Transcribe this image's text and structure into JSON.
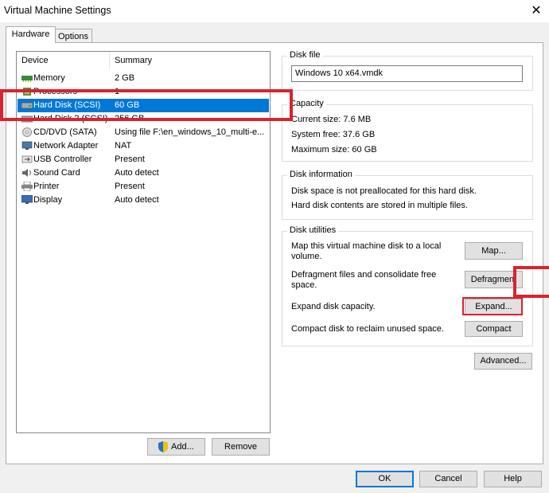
{
  "window": {
    "title": "Virtual Machine Settings",
    "close_glyph": "✕"
  },
  "tabs": [
    {
      "label": "Hardware"
    },
    {
      "label": "Options"
    }
  ],
  "device_list": {
    "headers": {
      "device": "Device",
      "summary": "Summary"
    },
    "rows": [
      {
        "device": "Memory",
        "summary": "2 GB",
        "icon": "memory-icon"
      },
      {
        "device": "Processors",
        "summary": "1",
        "icon": "processor-icon"
      },
      {
        "device": "Hard Disk (SCSI)",
        "summary": "60 GB",
        "icon": "hard-disk-icon",
        "selected": true
      },
      {
        "device": "Hard Disk 2 (SCSI)",
        "summary": "256 GB",
        "icon": "hard-disk-icon"
      },
      {
        "device": "CD/DVD (SATA)",
        "summary": "Using file F:\\en_windows_10_multi-e...",
        "icon": "cd-dvd-icon"
      },
      {
        "device": "Network Adapter",
        "summary": "NAT",
        "icon": "network-adapter-icon"
      },
      {
        "device": "USB Controller",
        "summary": "Present",
        "icon": "usb-icon"
      },
      {
        "device": "Sound Card",
        "summary": "Auto detect",
        "icon": "sound-card-icon"
      },
      {
        "device": "Printer",
        "summary": "Present",
        "icon": "printer-icon"
      },
      {
        "device": "Display",
        "summary": "Auto detect",
        "icon": "display-icon"
      }
    ]
  },
  "list_buttons": {
    "add": "Add...",
    "remove": "Remove"
  },
  "disk_file": {
    "title": "Disk file",
    "value": "Windows 10 x64.vmdk"
  },
  "capacity": {
    "title": "Capacity",
    "current": "Current size: 7.6 MB",
    "system_free": "System free: 37.6 GB",
    "maximum": "Maximum size: 60 GB"
  },
  "disk_information": {
    "title": "Disk information",
    "line1": "Disk space is not preallocated for this hard disk.",
    "line2": "Hard disk contents are stored in multiple files."
  },
  "disk_utilities": {
    "title": "Disk utilities",
    "map_text_1": "Map this virtual machine disk to a local",
    "map_text_2": "volume.",
    "map_button": "Map...",
    "defrag_text_1": "Defragment files and consolidate free",
    "defrag_text_2": "space.",
    "defrag_button": "Defragment",
    "expand_text": "Expand disk capacity.",
    "expand_button": "Expand...",
    "compact_text": "Compact disk to reclaim unused space.",
    "compact_button": "Compact"
  },
  "advanced_button": "Advanced...",
  "footer": {
    "ok": "OK",
    "cancel": "Cancel",
    "help": "Help"
  },
  "colors": {
    "selection": "#0078d7",
    "highlight_red": "#d9232e",
    "panel_bg": "#f0f0f0"
  }
}
